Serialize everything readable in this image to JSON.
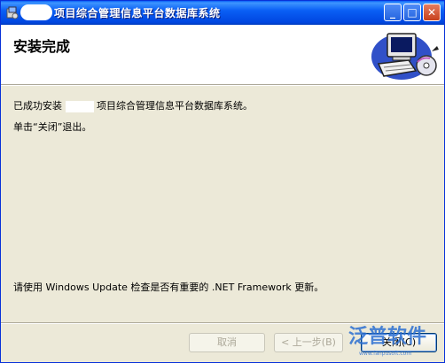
{
  "window": {
    "title": "项目综合管理信息平台数据库系统",
    "icons": {
      "app": "installer-icon",
      "minimize": "minimize-icon",
      "maximize": "maximize-icon",
      "close": "close-icon"
    },
    "minimize_glyph": "_",
    "maximize_glyph": "□",
    "close_glyph": "✕"
  },
  "header": {
    "title": "安装完成",
    "graphic": "computer-cd-icon"
  },
  "body": {
    "success_prefix": "已成功安装",
    "success_suffix": "项目综合管理信息平台数据库系统。",
    "instruction": "单击“关闭”退出。",
    "update_note": "请使用 Windows Update 检查是否有重要的 .NET Framework 更新。"
  },
  "buttons": {
    "cancel": "取消",
    "back": "< 上一步(B)",
    "close": "关闭(C)"
  },
  "watermark": {
    "text": "泛普软件",
    "url": "www.fanpusoft.com"
  },
  "colors": {
    "titlebar": "#0a5ff5",
    "dialog_bg": "#ece9d8",
    "disabled_text": "#aca899",
    "watermark": "#2c6fd1"
  }
}
